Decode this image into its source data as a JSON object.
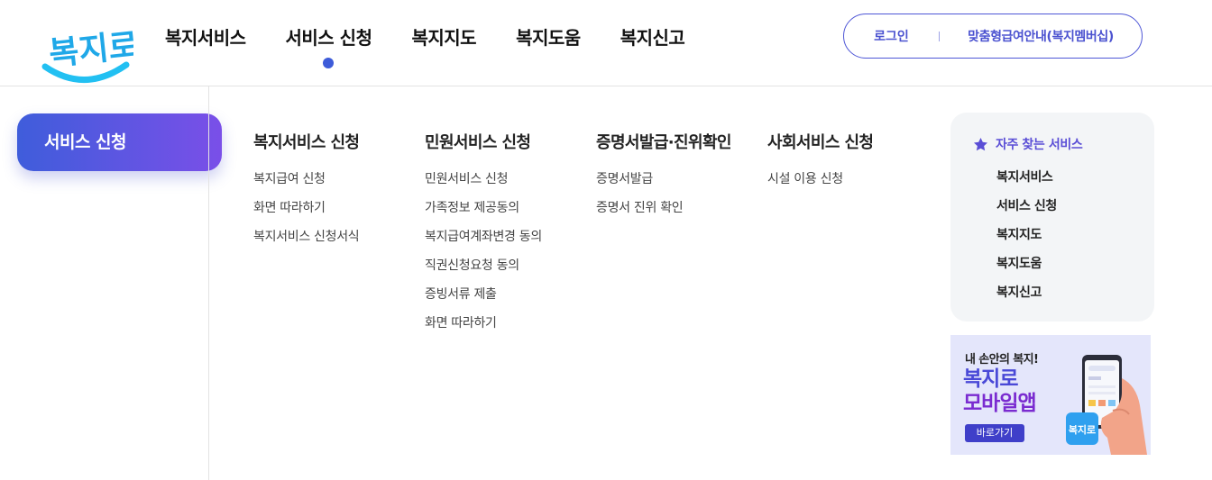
{
  "header": {
    "logo_alt": "복지로",
    "nav": [
      {
        "label": "복지서비스",
        "active": false
      },
      {
        "label": "서비스 신청",
        "active": true
      },
      {
        "label": "복지지도",
        "active": false
      },
      {
        "label": "복지도움",
        "active": false
      },
      {
        "label": "복지신고",
        "active": false
      }
    ],
    "util": {
      "login": "로그인",
      "guide": "맞춤형급여안내(복지멤버십)"
    }
  },
  "menu": {
    "section_title": "서비스 신청",
    "columns": [
      {
        "title": "복지서비스 신청",
        "links": [
          "복지급여 신청",
          "화면 따라하기",
          "복지서비스 신청서식"
        ]
      },
      {
        "title": "민원서비스 신청",
        "links": [
          "민원서비스 신청",
          "가족정보 제공동의",
          "복지급여계좌변경 동의",
          "직권신청요청 동의",
          "증빙서류 제출",
          "화면 따라하기"
        ]
      },
      {
        "title": "증명서발급·진위확인",
        "links": [
          "증명서발급",
          "증명서 진위 확인"
        ]
      },
      {
        "title": "사회서비스 신청",
        "links": [
          "시설 이용 신청"
        ]
      }
    ]
  },
  "favorites": {
    "title": "자주 찾는 서비스",
    "items": [
      "복지서비스",
      "서비스 신청",
      "복지지도",
      "복지도움",
      "복지신고"
    ]
  },
  "banner": {
    "subtitle": "내 손안의 복지!",
    "title_line1": "복지로",
    "title_line2": "모바일앱",
    "button": "바로가기",
    "app_icon_text": "복지로"
  },
  "colors": {
    "brand_blue": "#3d5bd9",
    "brand_purple": "#7a4fe8",
    "logo_cyan": "#1fb6f0"
  }
}
